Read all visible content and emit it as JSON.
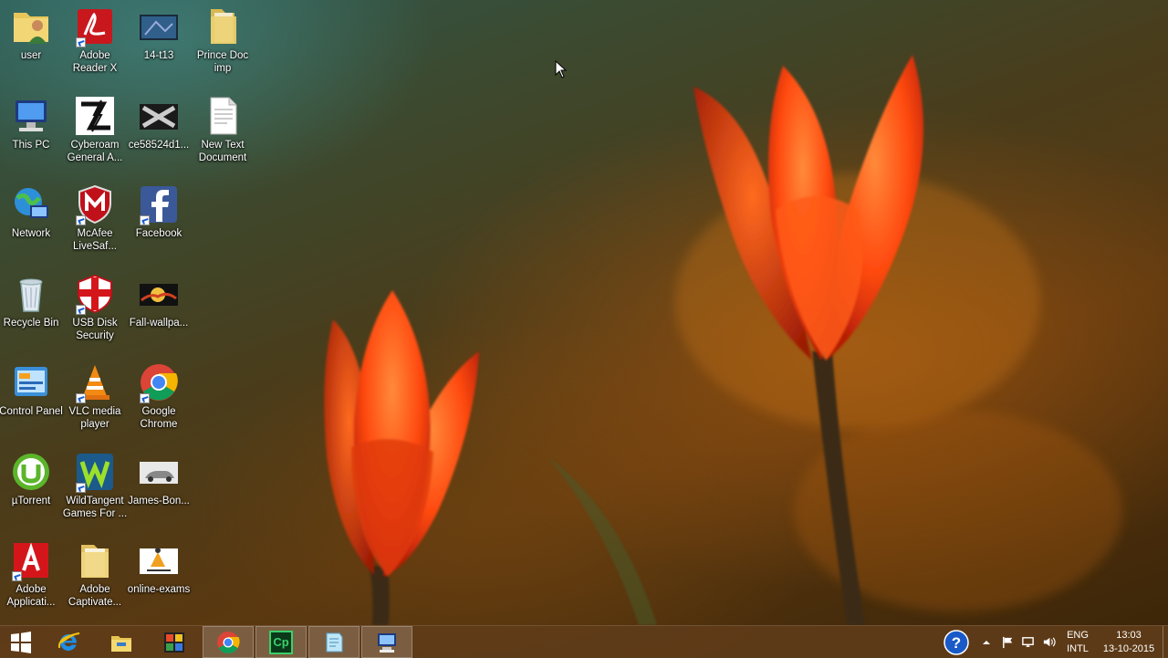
{
  "desktop_icons": [
    {
      "label": "user",
      "icon": "user-folder-icon"
    },
    {
      "label": "Adobe Reader X",
      "icon": "adobe-reader-icon"
    },
    {
      "label": "14-t13",
      "icon": "image-file-icon"
    },
    {
      "label": "Prince Doc imp",
      "icon": "folder-icon"
    },
    {
      "label": "This PC",
      "icon": "computer-icon"
    },
    {
      "label": "Cyberoam General A...",
      "icon": "cyberoam-icon"
    },
    {
      "label": "ce58524d1...",
      "icon": "image-file-icon"
    },
    {
      "label": "New Text Document",
      "icon": "text-document-icon"
    },
    {
      "label": "Network",
      "icon": "network-icon"
    },
    {
      "label": "McAfee LiveSaf...",
      "icon": "mcafee-icon"
    },
    {
      "label": "Facebook",
      "icon": "facebook-icon"
    },
    {
      "label": "Recycle Bin",
      "icon": "recycle-bin-icon"
    },
    {
      "label": "USB Disk Security",
      "icon": "shield-icon"
    },
    {
      "label": "Fall-wallpa...",
      "icon": "image-file-icon"
    },
    {
      "label": "Control Panel",
      "icon": "control-panel-icon"
    },
    {
      "label": "VLC media player",
      "icon": "vlc-icon"
    },
    {
      "label": "Google Chrome",
      "icon": "chrome-icon"
    },
    {
      "label": "µTorrent",
      "icon": "utorrent-icon"
    },
    {
      "label": "WildTangent Games For ...",
      "icon": "wildtangent-icon"
    },
    {
      "label": "James-Bon...",
      "icon": "image-file-icon"
    },
    {
      "label": "Adobe Applicati...",
      "icon": "adobe-app-manager-icon"
    },
    {
      "label": "Adobe Captivate...",
      "icon": "folder-icon"
    },
    {
      "label": "online-exams",
      "icon": "image-file-icon"
    }
  ],
  "taskbar": {
    "pinned": [
      {
        "name": "start-button",
        "icon": "windows-logo-icon"
      },
      {
        "name": "internet-explorer",
        "icon": "internet-explorer-icon"
      },
      {
        "name": "file-explorer",
        "icon": "file-explorer-icon"
      },
      {
        "name": "puzzle-app",
        "icon": "puzzle-icon"
      },
      {
        "name": "google-chrome",
        "icon": "chrome-icon"
      },
      {
        "name": "adobe-captivate",
        "icon": "captivate-icon",
        "text": "Cp"
      },
      {
        "name": "notepad-window",
        "icon": "notepad-icon"
      },
      {
        "name": "remote-desktop",
        "icon": "remote-desktop-icon"
      }
    ],
    "tray": {
      "help_icon": "help-icon",
      "language_top": "ENG",
      "language_bottom": "INTL",
      "time": "13:03",
      "date": "13-10-2015"
    }
  },
  "colors": {
    "taskbar": "#5f3c19",
    "tulip": "#ff4a10"
  }
}
